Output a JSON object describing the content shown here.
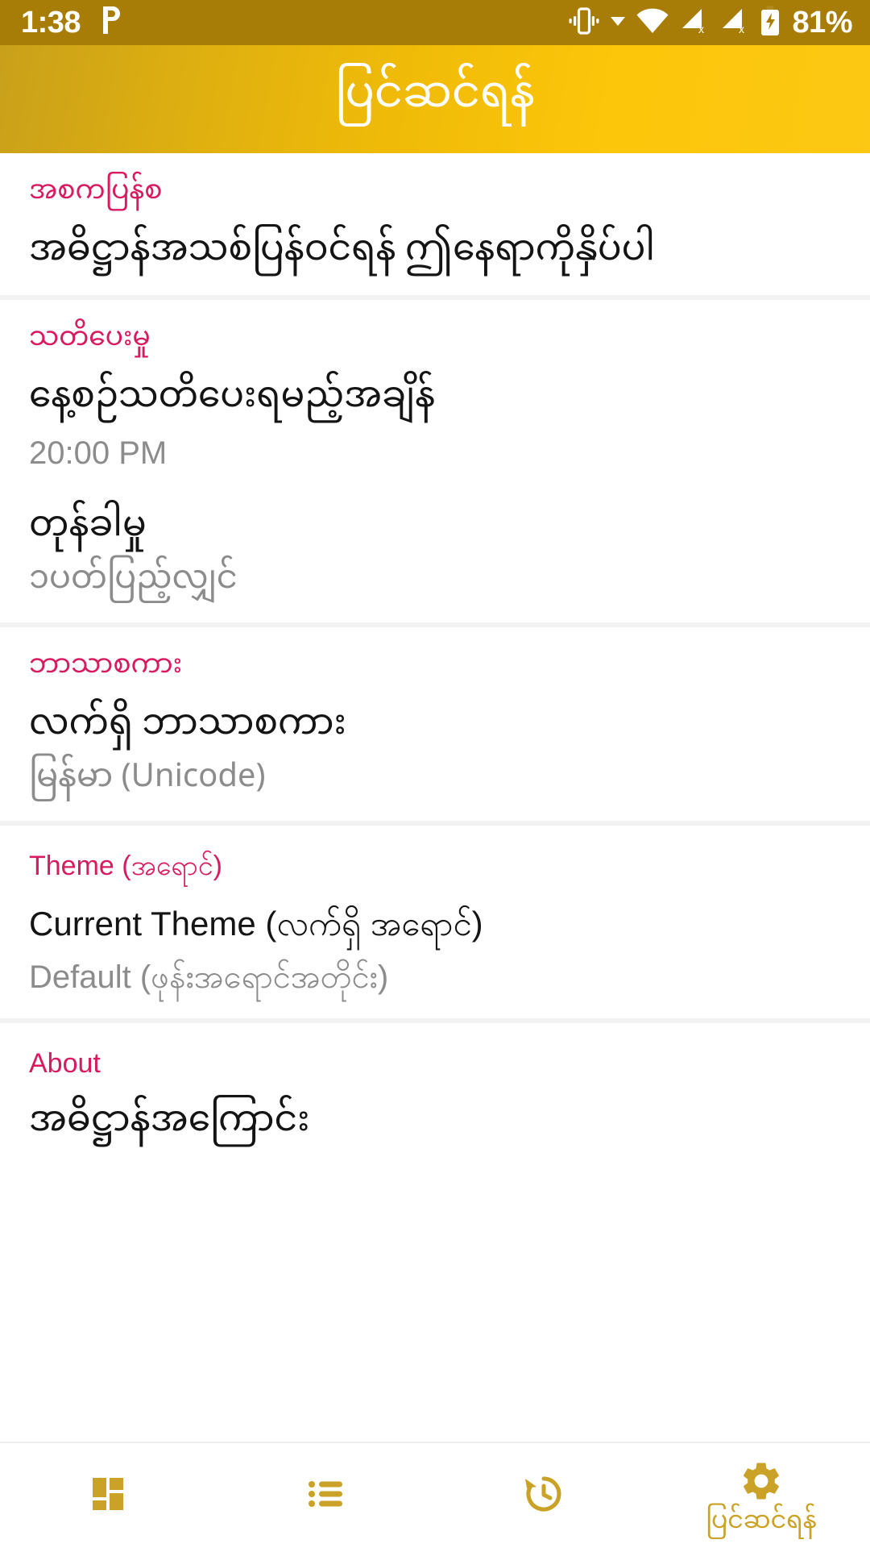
{
  "status_bar": {
    "time": "1:38",
    "pin_icon": "parking-p-icon",
    "icons": [
      "vibrate-icon",
      "dropdown-caret-icon",
      "wifi-icon",
      "signal-no-sim-1-icon",
      "signal-no-sim-2-icon",
      "battery-charging-icon"
    ],
    "battery_percent": "81%",
    "background_color": "#a87d07",
    "foreground_color": "#ffffff"
  },
  "app_bar": {
    "title": "ပြင်ဆင်ရန်",
    "gradient_start": "#c9a01a",
    "gradient_end": "#fdc813",
    "title_color": "#ffffff"
  },
  "theme_colors": {
    "section_header": "#d81b60",
    "primary_text": "#141414",
    "secondary_text": "#8c8c8c",
    "accent_gold": "#c9a227",
    "divider": "#f2f2f2"
  },
  "sections": [
    {
      "header": "အစကပြန်စ",
      "header_latin": false,
      "rows": [
        {
          "title": "အဓိဋ္ဌာန်အသစ်ပြန်ဝင်ရန် ဤနေရာကိုနှိပ်ပါ",
          "title_latin": false,
          "sub": "",
          "sub_latin": false
        }
      ]
    },
    {
      "header": "သတိပေးမှု",
      "header_latin": false,
      "rows": [
        {
          "title": "နေ့စဉ်သတိပေးရမည့်အချိန်",
          "title_latin": false,
          "sub": "20:00 PM",
          "sub_latin": true
        },
        {
          "title": "တုန်ခါမှု",
          "title_latin": false,
          "sub": "၁ပတ်ပြည့်လျှင်",
          "sub_latin": false
        }
      ]
    },
    {
      "header": "ဘာသာစကား",
      "header_latin": false,
      "rows": [
        {
          "title": "လက်ရှိ ဘာသာစကား",
          "title_latin": false,
          "sub": "မြန်မာ (Unicode)",
          "sub_latin": false
        }
      ]
    },
    {
      "header": "Theme (အရောင်)",
      "header_latin": true,
      "rows": [
        {
          "title": "Current Theme (လက်ရှိ အရောင်)",
          "title_latin": true,
          "sub": "Default (ဖုန်းအရောင်အတိုင်း)",
          "sub_latin": true
        }
      ]
    },
    {
      "header": "About",
      "header_latin": true,
      "rows": [
        {
          "title": "အဓိဋ္ဌာန်အကြောင်း",
          "title_latin": false,
          "sub": "",
          "sub_latin": false
        }
      ]
    }
  ],
  "bottom_nav": {
    "items": [
      {
        "icon": "dashboard-grid-icon",
        "label": "",
        "active": false
      },
      {
        "icon": "list-icon",
        "label": "",
        "active": false
      },
      {
        "icon": "history-clock-icon",
        "label": "",
        "active": false
      },
      {
        "icon": "gear-icon",
        "label": "ပြင်ဆင်ရန်",
        "active": true
      }
    ]
  }
}
